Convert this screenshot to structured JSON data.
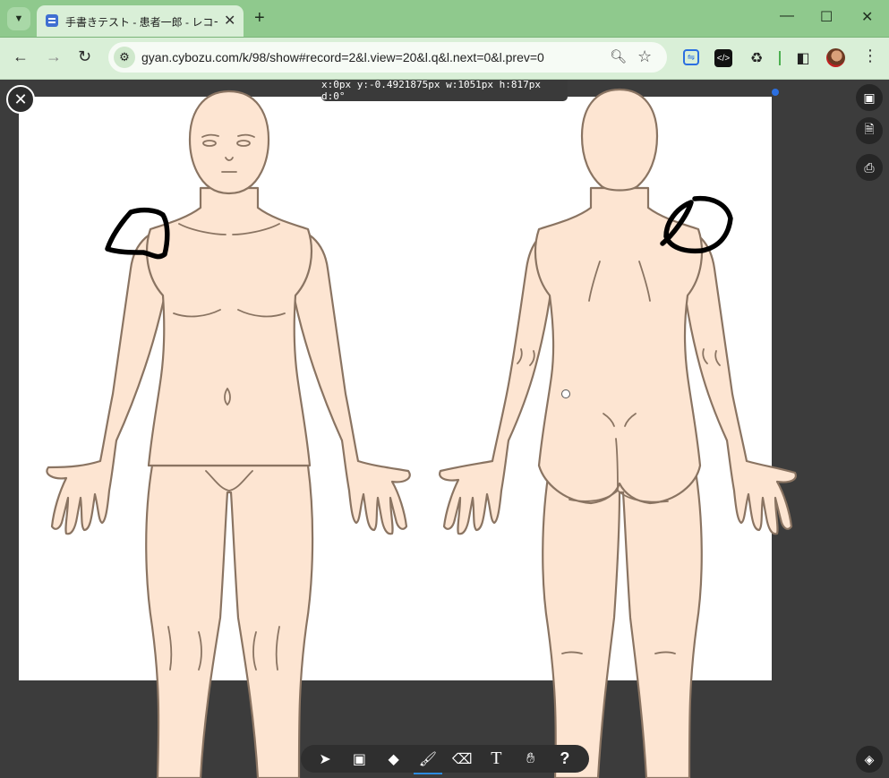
{
  "browser": {
    "tab_title": "手書きテスト - 患者一郎 - レコード",
    "url": "gyan.cybozu.com/k/98/show#record=2&l.view=20&l.q&l.next=0&l.prev=0",
    "icons": {
      "tab_search": "chevron-down-icon",
      "tab_close": "close-icon",
      "new_tab": "plus-icon",
      "back": "arrow-left-icon",
      "forward": "arrow-right-icon",
      "reload": "reload-icon",
      "zoom": "magnifier-icon",
      "bookmark": "star-icon",
      "menu": "kebab-icon"
    }
  },
  "editor": {
    "readout": "x:0px  y:-0.4921875px  w:1051px  h:817px  d:0°",
    "tools": [
      "select-move",
      "image",
      "shapes",
      "brush",
      "eraser",
      "text",
      "hand",
      "help"
    ],
    "active_tool": "brush",
    "tool_labels": {
      "text": "T",
      "help": "?"
    },
    "annotation_color": "#000000",
    "skin_color": "#fde5d2",
    "outline_color": "#8a7462"
  }
}
